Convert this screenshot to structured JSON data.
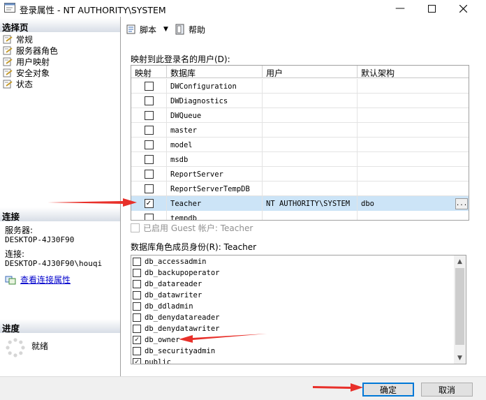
{
  "window": {
    "title": "登录属性 - NT AUTHORITY\\SYSTEM"
  },
  "left": {
    "select_page_header": "选择页",
    "pages": [
      {
        "label": "常规"
      },
      {
        "label": "服务器角色"
      },
      {
        "label": "用户映射"
      },
      {
        "label": "安全对象"
      },
      {
        "label": "状态"
      }
    ],
    "connection_header": "连接",
    "server_label": "服务器:",
    "server_value": "DESKTOP-4J30F90",
    "connection_label": "连接:",
    "connection_value": "DESKTOP-4J30F90\\houqi",
    "view_connection_link": "查看连接属性",
    "progress_header": "进度",
    "progress_status": "就绪"
  },
  "toolbar": {
    "script_label": "脚本",
    "help_label": "帮助"
  },
  "mapping": {
    "label": "映射到此登录名的用户(D):",
    "columns": [
      "映射",
      "数据库",
      "用户",
      "默认架构"
    ],
    "rows": [
      {
        "mapped": false,
        "database": "DWConfiguration",
        "user": "",
        "schema": ""
      },
      {
        "mapped": false,
        "database": "DWDiagnostics",
        "user": "",
        "schema": ""
      },
      {
        "mapped": false,
        "database": "DWQueue",
        "user": "",
        "schema": ""
      },
      {
        "mapped": false,
        "database": "master",
        "user": "",
        "schema": ""
      },
      {
        "mapped": false,
        "database": "model",
        "user": "",
        "schema": ""
      },
      {
        "mapped": false,
        "database": "msdb",
        "user": "",
        "schema": ""
      },
      {
        "mapped": false,
        "database": "ReportServer",
        "user": "",
        "schema": ""
      },
      {
        "mapped": false,
        "database": "ReportServerTempDB",
        "user": "",
        "schema": ""
      },
      {
        "mapped": true,
        "database": "Teacher",
        "user": "NT AUTHORITY\\SYSTEM",
        "schema": "dbo",
        "selected": true
      },
      {
        "mapped": false,
        "database": "tempdb",
        "user": "",
        "schema": ""
      }
    ],
    "ellipsis": "..."
  },
  "guest": {
    "label": "已启用 Guest 帐户: Teacher"
  },
  "roles": {
    "label": "数据库角色成员身份(R): Teacher",
    "items": [
      {
        "name": "db_accessadmin",
        "checked": false
      },
      {
        "name": "db_backupoperator",
        "checked": false
      },
      {
        "name": "db_datareader",
        "checked": false
      },
      {
        "name": "db_datawriter",
        "checked": false
      },
      {
        "name": "db_ddladmin",
        "checked": false
      },
      {
        "name": "db_denydatareader",
        "checked": false
      },
      {
        "name": "db_denydatawriter",
        "checked": false
      },
      {
        "name": "db_owner",
        "checked": true
      },
      {
        "name": "db_securityadmin",
        "checked": false
      },
      {
        "name": "public",
        "checked": true
      }
    ]
  },
  "buttons": {
    "ok": "确定",
    "cancel": "取消"
  },
  "icons": {
    "window": "window-icon",
    "minimize": "minimize-icon",
    "maximize": "maximize-icon",
    "close": "close-icon",
    "page": "page-icon",
    "script": "script-icon",
    "help": "help-icon",
    "progress": "spinner-icon",
    "connection": "connection-properties-icon"
  },
  "colors": {
    "accent": "#0078d7",
    "selection": "#cce4f7",
    "annotation": "#e8302a"
  }
}
